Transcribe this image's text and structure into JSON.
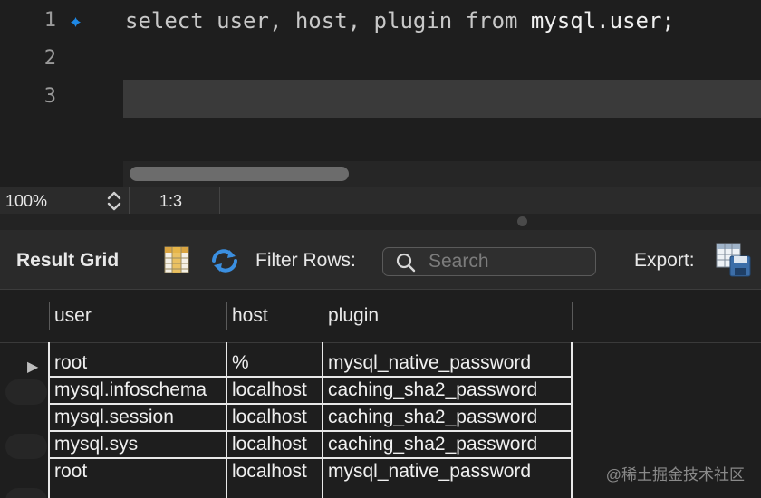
{
  "editor": {
    "line_numbers": [
      "1",
      "2",
      "3"
    ],
    "code": {
      "kw_select": "select",
      "plain_user": " user, host, plugin ",
      "kw_from": "from",
      "plain_table": " mysql.user;"
    },
    "marker_color": "#1e88e5"
  },
  "status": {
    "zoom": "100%",
    "cursor": "1:3"
  },
  "toolbar": {
    "title": "Result Grid",
    "filter_label": "Filter Rows:",
    "search_placeholder": "Search",
    "export_label": "Export:",
    "icons": [
      "grid-view-icon",
      "refresh-icon",
      "search-icon",
      "export-icon"
    ]
  },
  "grid": {
    "columns": [
      "user",
      "host",
      "plugin"
    ],
    "rows": [
      [
        "root",
        "%",
        "mysql_native_password"
      ],
      [
        "mysql.infoschema",
        "localhost",
        "caching_sha2_password"
      ],
      [
        "mysql.session",
        "localhost",
        "caching_sha2_password"
      ],
      [
        "mysql.sys",
        "localhost",
        "caching_sha2_password"
      ],
      [
        "root",
        "localhost",
        "mysql_native_password"
      ]
    ],
    "row_indicator": "▶"
  },
  "watermark": "@稀土掘金技术社区"
}
